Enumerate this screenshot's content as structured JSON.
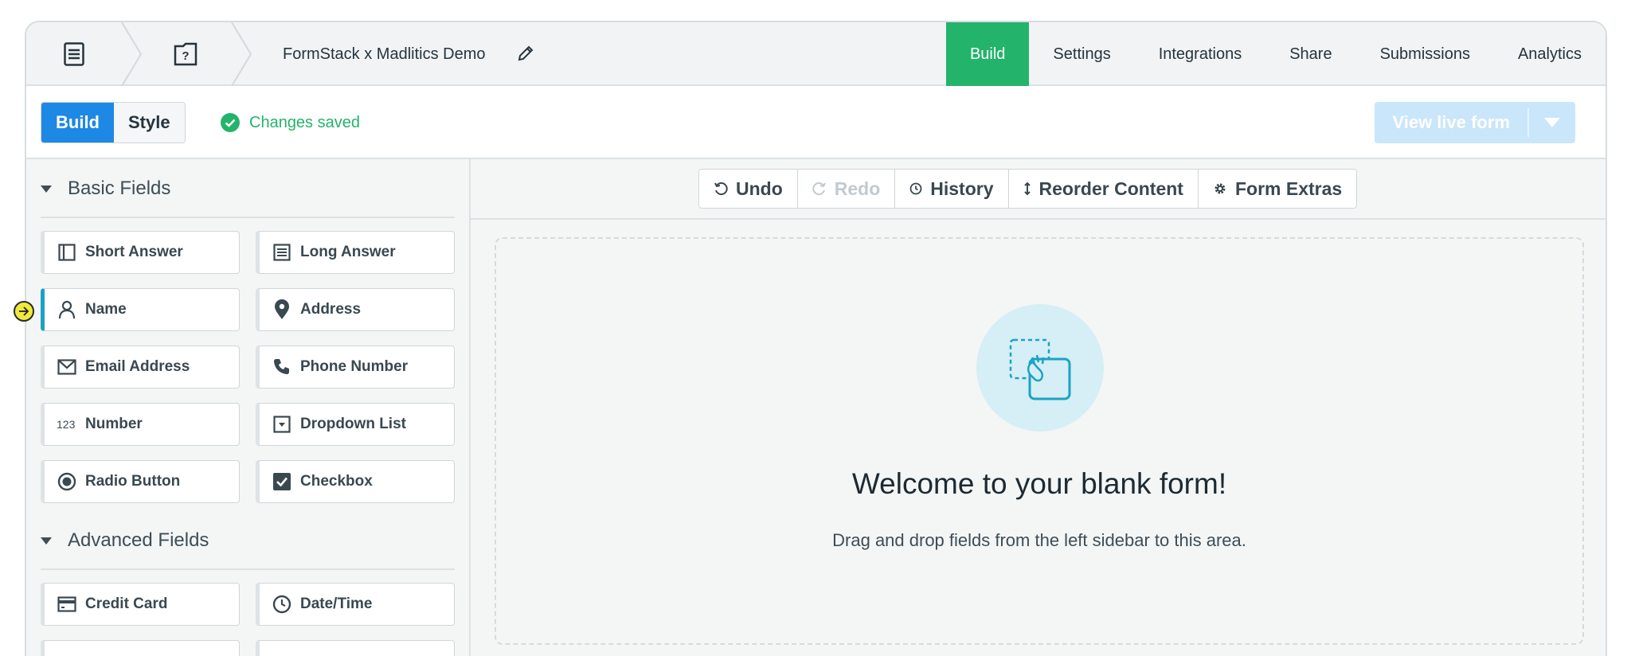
{
  "header": {
    "form_title": "FormStack x Madlitics Demo",
    "tabs": [
      {
        "label": "Build",
        "active": true
      },
      {
        "label": "Settings"
      },
      {
        "label": "Integrations"
      },
      {
        "label": "Share"
      },
      {
        "label": "Submissions"
      },
      {
        "label": "Analytics"
      }
    ]
  },
  "subbar": {
    "mode_build": "Build",
    "mode_style": "Style",
    "status": "Changes saved",
    "view_live": "View live form"
  },
  "sidebar": {
    "basic_title": "Basic Fields",
    "advanced_title": "Advanced Fields",
    "basic_fields": [
      {
        "label": "Short Answer",
        "icon": "short-answer-icon"
      },
      {
        "label": "Long Answer",
        "icon": "long-answer-icon"
      },
      {
        "label": "Name",
        "icon": "person-icon"
      },
      {
        "label": "Address",
        "icon": "map-pin-icon"
      },
      {
        "label": "Email Address",
        "icon": "envelope-icon"
      },
      {
        "label": "Phone Number",
        "icon": "phone-icon"
      },
      {
        "label": "Number",
        "icon": "number-icon"
      },
      {
        "label": "Dropdown List",
        "icon": "dropdown-icon"
      },
      {
        "label": "Radio Button",
        "icon": "radio-icon"
      },
      {
        "label": "Checkbox",
        "icon": "checkbox-icon"
      }
    ],
    "advanced_fields": [
      {
        "label": "Credit Card",
        "icon": "credit-card-icon"
      },
      {
        "label": "Date/Time",
        "icon": "clock-icon"
      }
    ]
  },
  "toolbar": {
    "undo": "Undo",
    "redo": "Redo",
    "history": "History",
    "reorder": "Reorder Content",
    "extras": "Form Extras"
  },
  "canvas": {
    "welcome": "Welcome to your blank form!",
    "instructions": "Drag and drop fields from the left sidebar to this area."
  },
  "colors": {
    "accent_green": "#24b36b",
    "accent_blue": "#1e88e5",
    "teal": "#1aa3c4"
  }
}
